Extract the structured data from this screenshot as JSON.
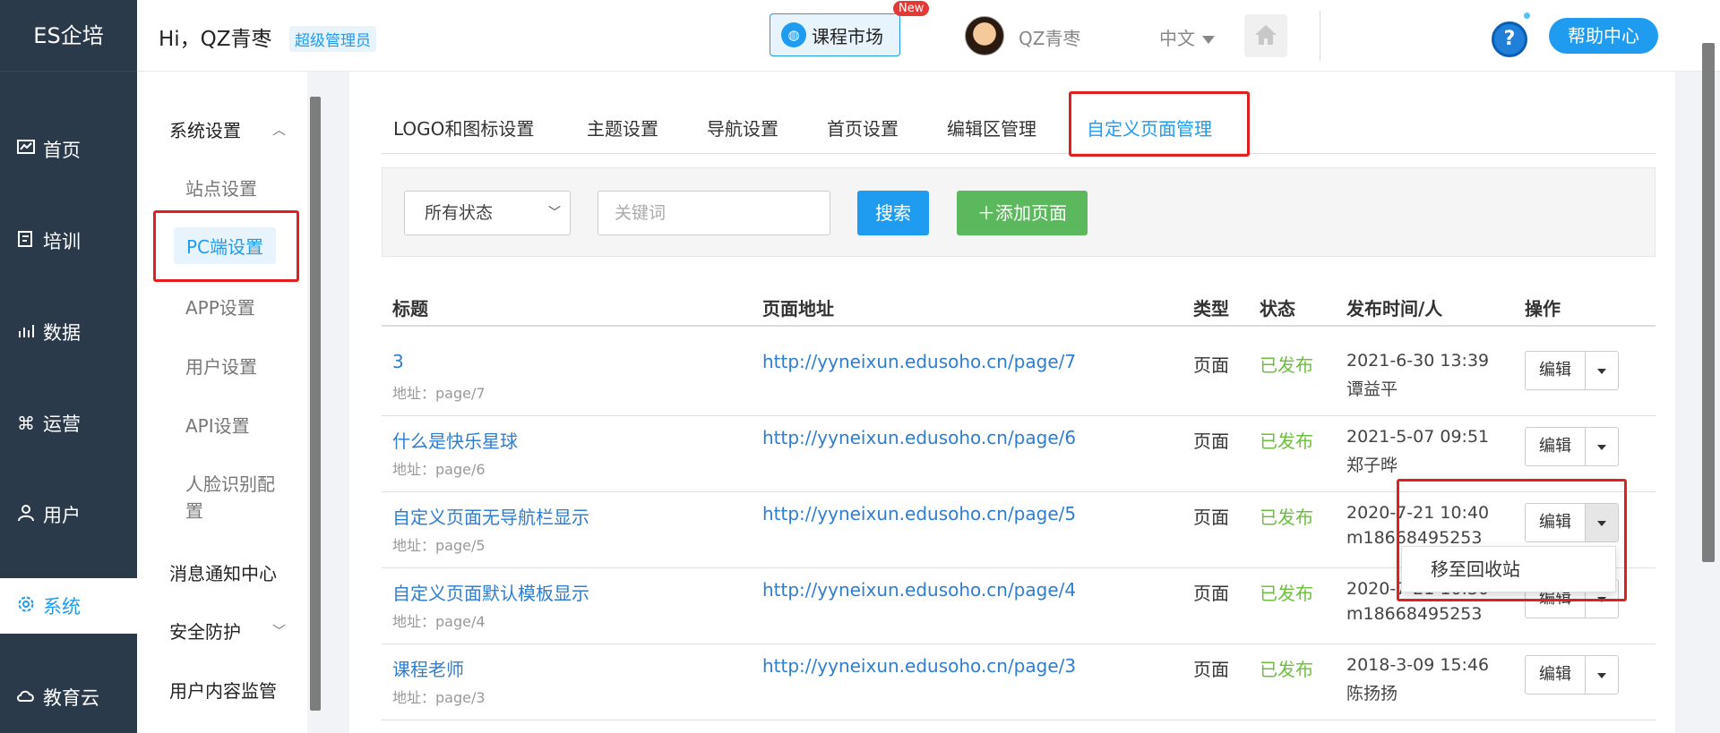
{
  "app": {
    "brand": "ES企培"
  },
  "sidebar": {
    "items": [
      {
        "label": "首页",
        "icon": "chart-icon"
      },
      {
        "label": "培训",
        "icon": "book-icon"
      },
      {
        "label": "数据",
        "icon": "stats-icon"
      },
      {
        "label": "运营",
        "icon": "command-icon"
      },
      {
        "label": "用户",
        "icon": "user-icon"
      },
      {
        "label": "系统",
        "icon": "gear-icon",
        "active": true
      },
      {
        "label": "教育云",
        "icon": "cloud-icon"
      }
    ]
  },
  "header": {
    "greeting": "Hi，QZ青枣",
    "role_badge": "超级管理员",
    "market_label": "课程市场",
    "new_badge": "New",
    "username": "QZ青枣",
    "language": "中文",
    "help_label": "帮助中心",
    "help_icon_text": "?",
    "collapse_glyph": "«"
  },
  "subnav": {
    "system_group": "系统设置",
    "items": [
      "站点设置",
      "PC端设置",
      "APP设置",
      "用户设置",
      "API设置",
      "人脸识别配置"
    ],
    "selected": "PC端设置",
    "notice_group": "消息通知中心",
    "security_group": "安全防护",
    "content_group": "用户内容监管"
  },
  "tabs": [
    "LOGO和图标设置",
    "主题设置",
    "导航设置",
    "首页设置",
    "编辑区管理",
    "自定义页面管理"
  ],
  "active_tab": "自定义页面管理",
  "filters": {
    "status_value": "所有状态",
    "keyword_placeholder": "关键词",
    "search_label": "搜索",
    "add_label": "＋添加页面"
  },
  "table": {
    "headers": [
      "标题",
      "页面地址",
      "类型",
      "状态",
      "发布时间/人",
      "操作"
    ],
    "rows": [
      {
        "title": "3",
        "addr": "地址：page/7",
        "url": "http://yyneixun.edusoho.cn/page/7",
        "type": "页面",
        "status": "已发布",
        "time": "2021-6-30 13:39",
        "person": "谭益平"
      },
      {
        "title": "什么是快乐星球",
        "addr": "地址：page/6",
        "url": "http://yyneixun.edusoho.cn/page/6",
        "type": "页面",
        "status": "已发布",
        "time": "2021-5-07 09:51",
        "person": "郑子晔"
      },
      {
        "title": "自定义页面无导航栏显示",
        "addr": "地址：page/5",
        "url": "http://yyneixun.edusoho.cn/page/5",
        "type": "页面",
        "status": "已发布",
        "time": "2020-7-21 10:40",
        "person": "m18668495253"
      },
      {
        "title": "自定义页面默认模板显示",
        "addr": "地址：page/4",
        "url": "http://yyneixun.edusoho.cn/page/4",
        "type": "页面",
        "status": "已发布",
        "time": "2020-7-21 10:30",
        "person": "m18668495253"
      },
      {
        "title": "课程老师",
        "addr": "地址：page/3",
        "url": "http://yyneixun.edusoho.cn/page/3",
        "type": "页面",
        "status": "已发布",
        "time": "2018-3-09 15:46",
        "person": "陈扬扬"
      }
    ],
    "edit_label": "编辑",
    "dropdown_item": "移至回收站"
  },
  "colors": {
    "accent": "#1f9bf0",
    "sidebar_bg": "#2b3a4b",
    "success": "#6cbf3d",
    "add_button": "#5cb85c",
    "highlight": "#e02020"
  }
}
